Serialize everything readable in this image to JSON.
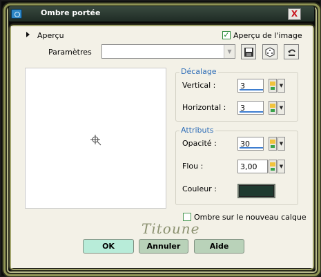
{
  "window": {
    "title": "Ombre portée",
    "close_label": "X"
  },
  "preview_section": {
    "label": "Aperçu",
    "image_preview_label": "Aperçu de l'image",
    "image_preview_checked": true
  },
  "presets": {
    "label": "Paramètres",
    "value": ""
  },
  "offset_group": {
    "title": "Décalage",
    "vertical": {
      "label": "Vertical :",
      "value": "3"
    },
    "horizontal": {
      "label": "Horizontal :",
      "value": "3"
    }
  },
  "attributes_group": {
    "title": "Attributs",
    "opacity": {
      "label": "Opacité :",
      "value": "30"
    },
    "blur": {
      "label": "Flou :",
      "value": "3,00"
    },
    "color": {
      "label": "Couleur :",
      "value": "#1f3b30"
    }
  },
  "new_layer": {
    "label": "Ombre sur le nouveau calque",
    "checked": false
  },
  "signature": "Titoune",
  "buttons": {
    "ok": "OK",
    "cancel": "Annuler",
    "help": "Aide"
  }
}
